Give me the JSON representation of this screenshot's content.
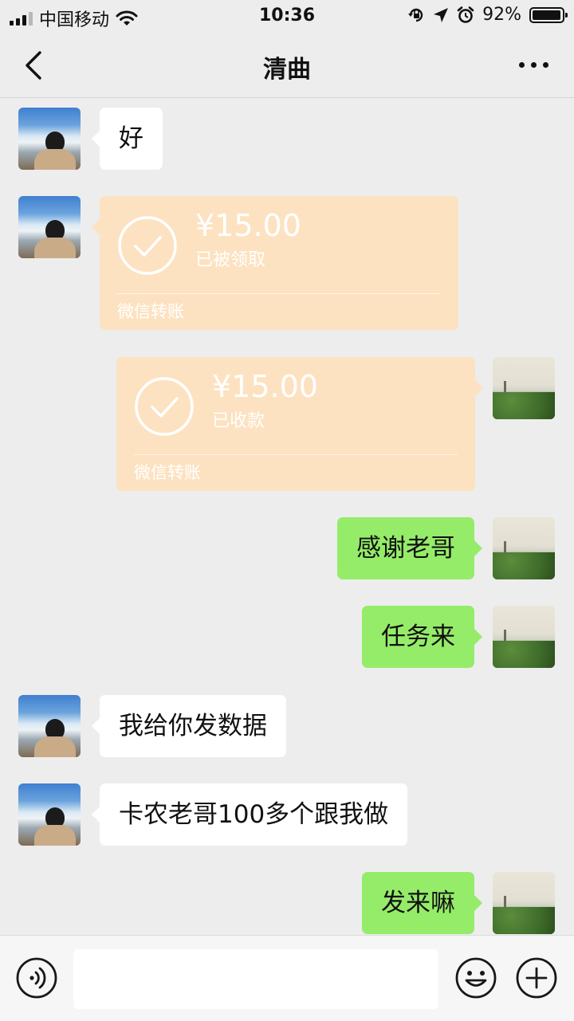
{
  "status_bar": {
    "carrier": "中国移动",
    "time": "10:36",
    "battery": "92%",
    "icons": [
      "signal-icon",
      "wifi-icon",
      "orientation-lock-icon",
      "location-arrow-icon",
      "alarm-icon",
      "battery-icon"
    ]
  },
  "nav": {
    "title": "清曲",
    "icons": [
      "back-chevron-icon",
      "more-dots-icon"
    ]
  },
  "messages": [
    {
      "from": "other",
      "type": "text",
      "text": "好"
    },
    {
      "from": "other",
      "type": "transfer",
      "amount": "¥15.00",
      "status": "已被领取",
      "label": "微信转账"
    },
    {
      "from": "self",
      "type": "transfer",
      "amount": "¥15.00",
      "status": "已收款",
      "label": "微信转账"
    },
    {
      "from": "self",
      "type": "text",
      "text": "感谢老哥"
    },
    {
      "from": "self",
      "type": "text",
      "text": "任务来"
    },
    {
      "from": "other",
      "type": "text",
      "text": "我给你发数据"
    },
    {
      "from": "other",
      "type": "text",
      "text": "卡农老哥100多个跟我做"
    },
    {
      "from": "self",
      "type": "text",
      "text": "发来嘛"
    }
  ],
  "input_bar": {
    "value": "",
    "icons": [
      "voice-icon",
      "emoji-icon",
      "plus-icon"
    ]
  },
  "colors": {
    "chat_background": "#ededed",
    "self_bubble": "#95ec69",
    "other_bubble": "#ffffff",
    "transfer_card": "#fde2c1"
  }
}
